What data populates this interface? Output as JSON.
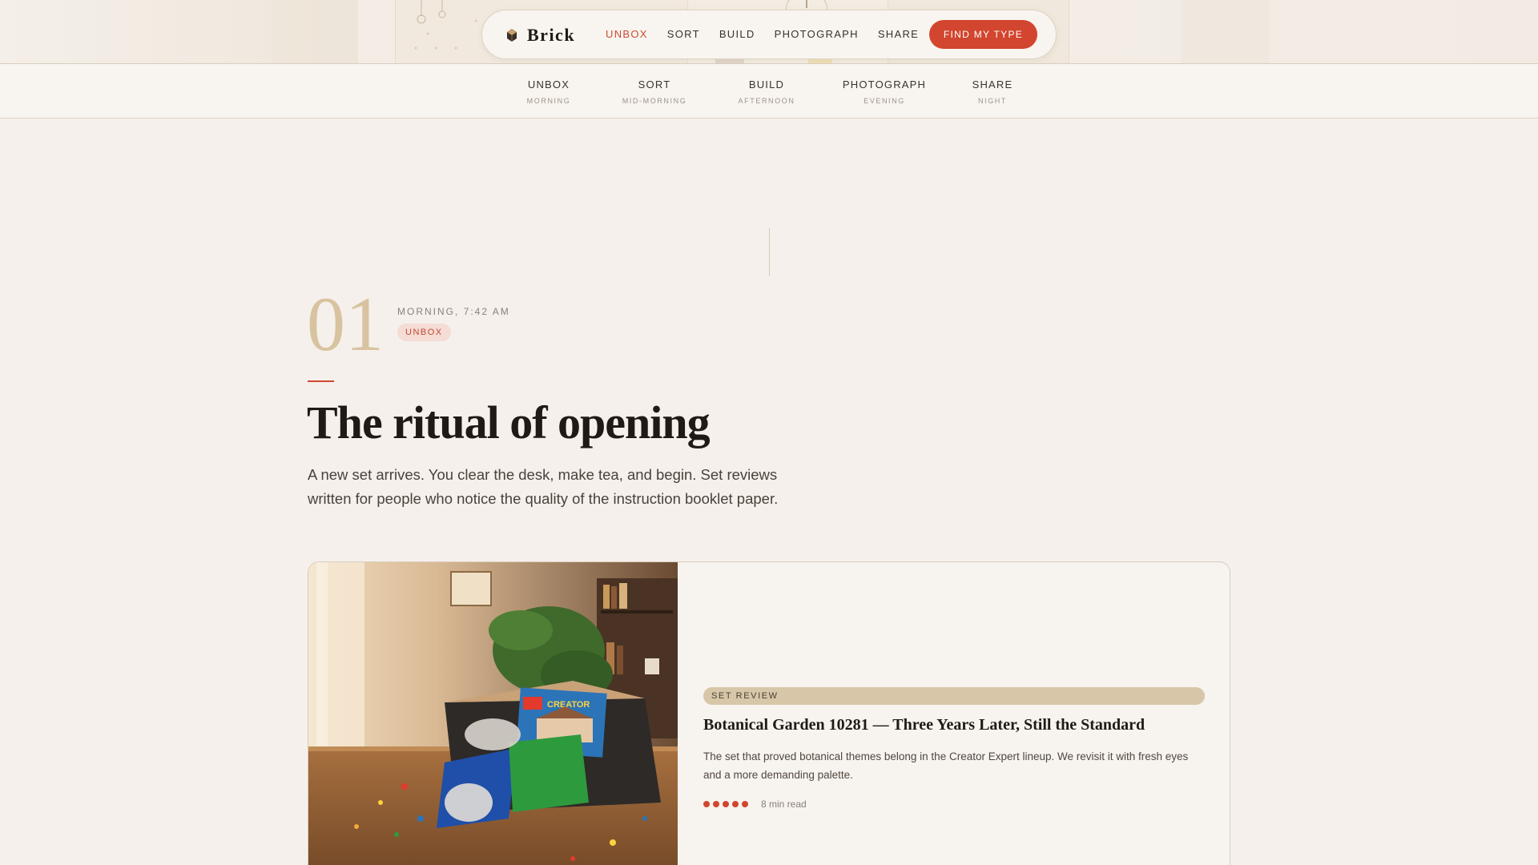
{
  "brand": {
    "name": "Brick",
    "icon": "brick-logo-icon"
  },
  "nav": {
    "links": [
      {
        "label": "UNBOX",
        "active": true
      },
      {
        "label": "SORT",
        "active": false
      },
      {
        "label": "BUILD",
        "active": false
      },
      {
        "label": "PHOTOGRAPH",
        "active": false
      },
      {
        "label": "SHARE",
        "active": false
      }
    ],
    "cta_label": "FIND MY TYPE"
  },
  "timeline": [
    {
      "label": "UNBOX",
      "time": "MORNING"
    },
    {
      "label": "SORT",
      "time": "MID-MORNING"
    },
    {
      "label": "BUILD",
      "time": "AFTERNOON"
    },
    {
      "label": "PHOTOGRAPH",
      "time": "EVENING"
    },
    {
      "label": "SHARE",
      "time": "NIGHT"
    }
  ],
  "section": {
    "number": "01",
    "meta": "MORNING, 7:42 AM",
    "tag": "UNBOX",
    "title": "The ritual of opening",
    "description": "A new set arrives. You clear the desk, make tea, and begin. Set reviews written for people who notice the quality of the instruction booklet paper."
  },
  "card": {
    "category": "SET REVIEW",
    "title": "Botanical Garden 10281 — Three Years Later, Still the Standard",
    "text": "The set that proved botanical themes belong in the Creator Expert lineup. We revisit it with fresh eyes and a more demanding palette.",
    "rating": 5,
    "read_time": "8 min read",
    "image_box_label": "CREATOR"
  },
  "colors": {
    "accent": "#d2452e",
    "background": "#f5f0eb",
    "numeral": "#d8c3a0",
    "tag_bg": "#f5dcd5",
    "category_bg": "#d7c6a8"
  }
}
